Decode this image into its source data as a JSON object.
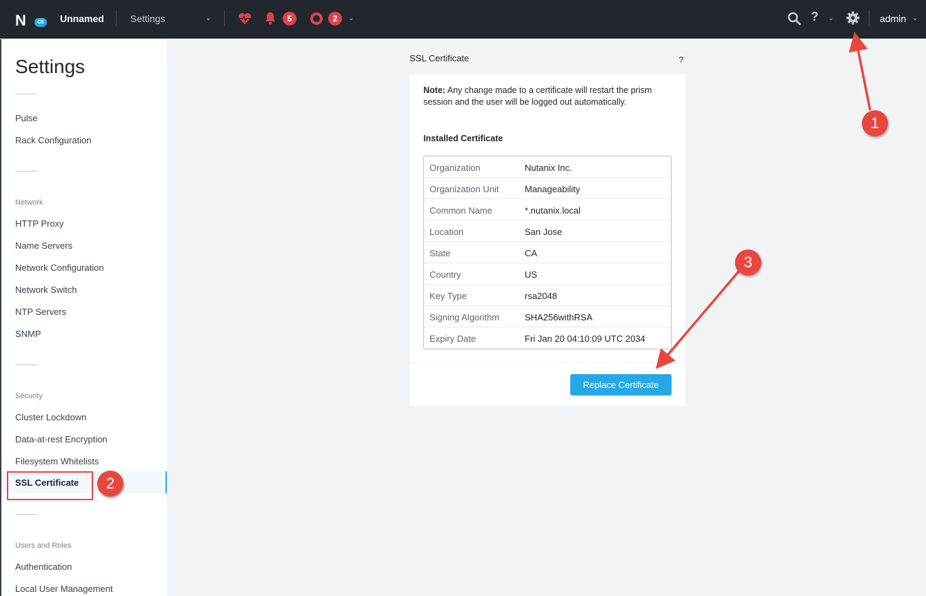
{
  "topbar": {
    "logo_letter": "N",
    "logo_badge": "CE",
    "cluster_name": "Unnamed",
    "view_select": "Settings",
    "alerts_count": "5",
    "events_count": "2",
    "help_label": "?",
    "user": "admin"
  },
  "sidebar": {
    "title": "Settings",
    "items_top": [
      "Pulse",
      "Rack Configuration"
    ],
    "network_group": "Network",
    "network_items": [
      "HTTP Proxy",
      "Name Servers",
      "Network Configuration",
      "Network Switch",
      "NTP Servers",
      "SNMP"
    ],
    "security_group": "Security",
    "security_items": [
      "Cluster Lockdown",
      "Data-at-rest Encryption",
      "Filesystem Whitelists"
    ],
    "active_item": "SSL Certificate",
    "users_group": "Users and Roles",
    "users_items": [
      "Authentication",
      "Local User Management"
    ]
  },
  "panel": {
    "title": "SSL Certificate",
    "help": "?",
    "note_label": "Note:",
    "note_text": " Any change made to a certificate will restart the prism session and the user will be logged out automatically.",
    "installed_heading": "Installed Certificate",
    "certificate": [
      {
        "key": "Organization",
        "value": "Nutanix Inc."
      },
      {
        "key": "Organization Unit",
        "value": "Manageability"
      },
      {
        "key": "Common Name",
        "value": "*.nutanix.local"
      },
      {
        "key": "Location",
        "value": "San Jose"
      },
      {
        "key": "State",
        "value": "CA"
      },
      {
        "key": "Country",
        "value": "US"
      },
      {
        "key": "Key Type",
        "value": "rsa2048"
      },
      {
        "key": "Signing Algorithm",
        "value": "SHA256withRSA"
      },
      {
        "key": "Expiry Date",
        "value": "Fri Jan 20 04:10:09 UTC 2034"
      }
    ],
    "replace_button": "Replace Certificate"
  },
  "annotations": {
    "step1": "1",
    "step2": "2",
    "step3": "3",
    "color": "#e8473f"
  },
  "colors": {
    "accent": "#26a8e6",
    "alert": "#e0424c",
    "topbar": "#22272e"
  }
}
